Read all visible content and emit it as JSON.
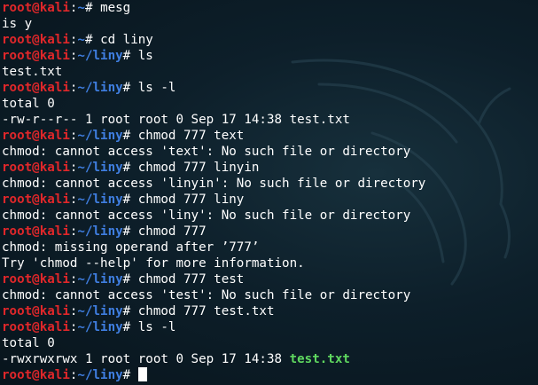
{
  "prompt": {
    "user": "root",
    "at": "@",
    "host": "kali",
    "colon": ":",
    "hash": "# "
  },
  "lines": [
    {
      "type": "prompt",
      "path": "~",
      "cmd": "mesg"
    },
    {
      "type": "output",
      "text": "is y"
    },
    {
      "type": "prompt",
      "path": "~",
      "cmd": "cd liny"
    },
    {
      "type": "prompt",
      "path": "~/liny",
      "cmd": "ls"
    },
    {
      "type": "output",
      "text": "test.txt"
    },
    {
      "type": "prompt",
      "path": "~/liny",
      "cmd": "ls -l"
    },
    {
      "type": "output",
      "text": "total 0"
    },
    {
      "type": "output",
      "text": "-rw-r--r-- 1 root root 0 Sep 17 14:38 test.txt"
    },
    {
      "type": "prompt",
      "path": "~/liny",
      "cmd": "chmod 777 text"
    },
    {
      "type": "output",
      "text": "chmod: cannot access 'text': No such file or directory"
    },
    {
      "type": "prompt",
      "path": "~/liny",
      "cmd": "chmod 777 linyin"
    },
    {
      "type": "output",
      "text": "chmod: cannot access 'linyin': No such file or directory"
    },
    {
      "type": "prompt",
      "path": "~/liny",
      "cmd": "chmod 777 liny"
    },
    {
      "type": "output",
      "text": "chmod: cannot access 'liny': No such file or directory"
    },
    {
      "type": "prompt",
      "path": "~/liny",
      "cmd": "chmod 777"
    },
    {
      "type": "output",
      "text": "chmod: missing operand after ’777’"
    },
    {
      "type": "output",
      "text": "Try 'chmod --help' for more information."
    },
    {
      "type": "prompt",
      "path": "~/liny",
      "cmd": "chmod 777 test"
    },
    {
      "type": "output",
      "text": "chmod: cannot access 'test': No such file or directory"
    },
    {
      "type": "prompt",
      "path": "~/liny",
      "cmd": "chmod 777 test.txt"
    },
    {
      "type": "prompt",
      "path": "~/liny",
      "cmd": "ls -l"
    },
    {
      "type": "output",
      "text": "total 0"
    },
    {
      "type": "output_file",
      "text": "-rwxrwxrwx 1 root root 0 Sep 17 14:38 ",
      "file": "test.txt"
    },
    {
      "type": "prompt_cursor",
      "path": "~/liny",
      "cmd": ""
    }
  ],
  "colors": {
    "user": "#e0272a",
    "path": "#3f7ee0",
    "text": "#ffffff",
    "executable_file": "#5fd75f",
    "background": "#0d1f2a"
  },
  "background_icon": "kali-dragon-watermark"
}
